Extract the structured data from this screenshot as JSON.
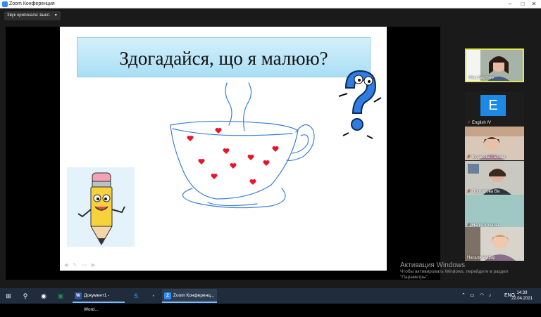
{
  "window": {
    "title": "Zoom Конференция"
  },
  "audio_chip": {
    "label": "Звук оригинала: выкл."
  },
  "slide": {
    "title": "Здогадайся, що я малюю?"
  },
  "participants": [
    {
      "name": "Ніна Бартник",
      "muted": false
    },
    {
      "name": "English IV",
      "muted": true,
      "initial": "E"
    },
    {
      "name": "Кудасова Галина",
      "muted": true
    },
    {
      "name": "Прозорова Вік",
      "muted": true
    },
    {
      "name": "Надія Козалы",
      "muted": true
    },
    {
      "name": "Наталя Чуфар",
      "muted": false
    }
  ],
  "watermark": {
    "heading": "Активация Windows",
    "line1": "Чтобы активировать Windows, перейдите в раздел",
    "line2": "\"Параметры\"."
  },
  "taskbar": {
    "tasks": [
      {
        "label": "Документ1 - Word...",
        "icon_label": "W"
      },
      {
        "label": "Zoom Конференц...",
        "icon_label": "Z"
      }
    ],
    "lang": "ENG",
    "time": "14:39",
    "date": "22.04.2021"
  },
  "colors": {
    "accent": "#2d8cff",
    "active_speaker": "#e1e84a",
    "hearts": "#e8142a",
    "sketch": "#3b7fd6"
  }
}
